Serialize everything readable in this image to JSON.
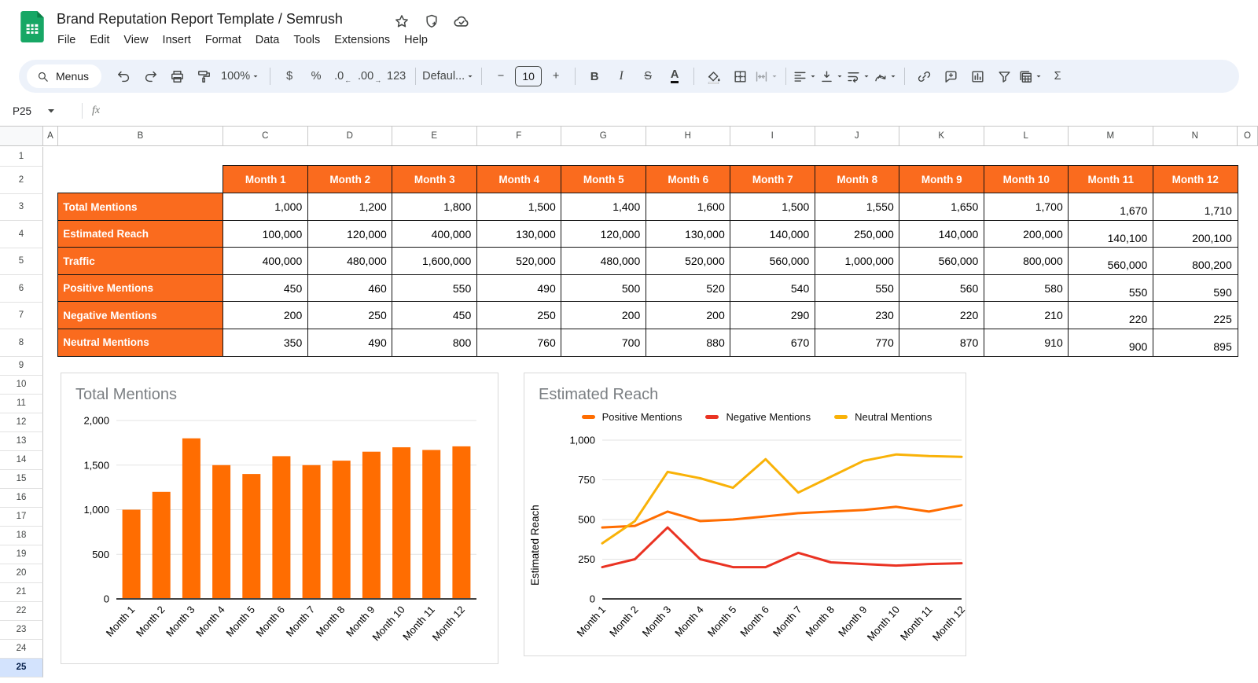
{
  "header": {
    "title": "Brand Reputation Report Template / Semrush",
    "menu_items": [
      "File",
      "Edit",
      "View",
      "Insert",
      "Format",
      "Data",
      "Tools",
      "Extensions",
      "Help"
    ],
    "title_icons": [
      "star-icon",
      "shield-plus-icon",
      "cloud-check-icon"
    ]
  },
  "toolbar": {
    "items": [
      {
        "name": "menus-search",
        "kind": "pill",
        "icon": "search",
        "label": "Menus"
      },
      {
        "name": "undo",
        "kind": "icon",
        "icon": "undo"
      },
      {
        "name": "redo",
        "kind": "icon",
        "icon": "redo"
      },
      {
        "name": "print",
        "kind": "icon",
        "icon": "print"
      },
      {
        "name": "paint-format",
        "kind": "icon",
        "icon": "paint"
      },
      {
        "name": "zoom",
        "kind": "textcaret",
        "label": "100%"
      },
      {
        "kind": "sep"
      },
      {
        "name": "format-as-currency",
        "kind": "text",
        "label": "$"
      },
      {
        "name": "format-as-percent",
        "kind": "text",
        "label": "%"
      },
      {
        "name": "decrease-decimal-places",
        "kind": "text",
        "label": ".0",
        "sub": "←"
      },
      {
        "name": "increase-decimal-places",
        "kind": "text",
        "label": ".00",
        "sub": "→"
      },
      {
        "name": "more-formats",
        "kind": "text",
        "label": "123"
      },
      {
        "kind": "sep"
      },
      {
        "name": "font",
        "kind": "textcaret",
        "label": "Defaul..."
      },
      {
        "kind": "sep"
      },
      {
        "name": "decrease-font-size",
        "kind": "text",
        "label": "−"
      },
      {
        "name": "font-size",
        "kind": "input",
        "label": "10"
      },
      {
        "name": "increase-font-size",
        "kind": "text",
        "label": "+"
      },
      {
        "kind": "sep"
      },
      {
        "name": "bold",
        "kind": "text",
        "label": "B",
        "cls": "b"
      },
      {
        "name": "italic",
        "kind": "text",
        "label": "I",
        "cls": "i"
      },
      {
        "name": "strikethrough",
        "kind": "text",
        "label": "S",
        "cls": "s"
      },
      {
        "name": "text-color",
        "kind": "text",
        "label": "A",
        "cls": "u"
      },
      {
        "kind": "sep"
      },
      {
        "name": "fill-color",
        "kind": "icon",
        "icon": "fill"
      },
      {
        "name": "borders",
        "kind": "icon",
        "icon": "borders"
      },
      {
        "name": "merge-cells",
        "kind": "iconcaret",
        "icon": "merge",
        "disabled": true
      },
      {
        "kind": "sep"
      },
      {
        "name": "horizontal-align",
        "kind": "iconcaret",
        "icon": "alignLeft"
      },
      {
        "name": "vertical-align",
        "kind": "iconcaret",
        "icon": "valign"
      },
      {
        "name": "text-wrapping",
        "kind": "iconcaret",
        "icon": "wrap"
      },
      {
        "name": "text-rotation",
        "kind": "iconcaret",
        "icon": "rotate"
      },
      {
        "kind": "sep"
      },
      {
        "name": "insert-link",
        "kind": "icon",
        "icon": "link"
      },
      {
        "name": "insert-comment",
        "kind": "icon",
        "icon": "comment"
      },
      {
        "name": "insert-chart",
        "kind": "icon",
        "icon": "chart"
      },
      {
        "name": "create-filter",
        "kind": "icon",
        "icon": "filter"
      },
      {
        "name": "table-views",
        "kind": "iconcaret",
        "icon": "tableViews"
      },
      {
        "name": "functions",
        "kind": "text",
        "label": "Σ"
      }
    ]
  },
  "formula_bar": {
    "name_box": "P25",
    "fx_label": "fx"
  },
  "grid": {
    "columns": [
      "A",
      "B",
      "C",
      "D",
      "E",
      "F",
      "G",
      "H",
      "I",
      "J",
      "K",
      "L",
      "M",
      "N",
      "O"
    ],
    "rows": [
      "1",
      "2",
      "3",
      "4",
      "5",
      "6",
      "7",
      "8",
      "9",
      "10",
      "11",
      "12",
      "13",
      "14",
      "15",
      "16",
      "17",
      "18",
      "19",
      "20",
      "21",
      "22",
      "23",
      "24",
      "25"
    ],
    "selected_row": "25"
  },
  "table": {
    "month_headers": [
      "Month 1",
      "Month 2",
      "Month 3",
      "Month 4",
      "Month 5",
      "Month 6",
      "Month 7",
      "Month 8",
      "Month 9",
      "Month 10",
      "Month 11",
      "Month 12"
    ],
    "rows": [
      {
        "label": "Total Mentions",
        "values": [
          "1,000",
          "1,200",
          "1,800",
          "1,500",
          "1,400",
          "1,600",
          "1,500",
          "1,550",
          "1,650",
          "1,700",
          "1,670",
          "1,710"
        ]
      },
      {
        "label": "Estimated Reach",
        "values": [
          "100,000",
          "120,000",
          "400,000",
          "130,000",
          "120,000",
          "130,000",
          "140,000",
          "250,000",
          "140,000",
          "200,000",
          "140,100",
          "200,100"
        ]
      },
      {
        "label": "Traffic",
        "values": [
          "400,000",
          "480,000",
          "1,600,000",
          "520,000",
          "480,000",
          "520,000",
          "560,000",
          "1,000,000",
          "560,000",
          "800,000",
          "560,000",
          "800,200"
        ]
      },
      {
        "label": "Positive Mentions",
        "values": [
          "450",
          "460",
          "550",
          "490",
          "500",
          "520",
          "540",
          "550",
          "560",
          "580",
          "550",
          "590"
        ]
      },
      {
        "label": "Negative Mentions",
        "values": [
          "200",
          "250",
          "450",
          "250",
          "200",
          "200",
          "290",
          "230",
          "220",
          "210",
          "220",
          "225"
        ]
      },
      {
        "label": "Neutral Mentions",
        "values": [
          "350",
          "490",
          "800",
          "760",
          "700",
          "880",
          "670",
          "770",
          "870",
          "910",
          "900",
          "895"
        ]
      }
    ]
  },
  "colors": {
    "table_orange": "#FA6B1E",
    "chart_orange": "#FF6D01",
    "chart_red": "#EA3323",
    "chart_yellow": "#F9B208",
    "selected_row_bg": "#d3e3fd",
    "toolbar_bg": "#edf2fa",
    "sheets_green": "#17A765"
  },
  "chart_data": [
    {
      "type": "bar",
      "title": "Total Mentions",
      "categories": [
        "Month 1",
        "Month 2",
        "Month 3",
        "Month 4",
        "Month 5",
        "Month 6",
        "Month 7",
        "Month 8",
        "Month 9",
        "Month 10",
        "Month 11",
        "Month 12"
      ],
      "values": [
        1000,
        1200,
        1800,
        1500,
        1400,
        1600,
        1500,
        1550,
        1650,
        1700,
        1670,
        1710
      ],
      "color": "#FF6D01",
      "xlabel": "",
      "ylabel": "",
      "ylim": [
        0,
        2000
      ],
      "yticks": [
        0,
        500,
        1000,
        1500,
        2000
      ],
      "grid": true,
      "legend_position": "none"
    },
    {
      "type": "line",
      "title": "Estimated Reach",
      "categories": [
        "Month 1",
        "Month 2",
        "Month 3",
        "Month 4",
        "Month 5",
        "Month 6",
        "Month 7",
        "Month 8",
        "Month 9",
        "Month 10",
        "Month 11",
        "Month 12"
      ],
      "series": [
        {
          "name": "Positive Mentions",
          "color": "#FF6D01",
          "values": [
            450,
            460,
            550,
            490,
            500,
            520,
            540,
            550,
            560,
            580,
            550,
            590
          ]
        },
        {
          "name": "Negative Mentions",
          "color": "#EA3323",
          "values": [
            200,
            250,
            450,
            250,
            200,
            200,
            290,
            230,
            220,
            210,
            220,
            225
          ]
        },
        {
          "name": "Neutral Mentions",
          "color": "#F9B208",
          "values": [
            350,
            490,
            800,
            760,
            700,
            880,
            670,
            770,
            870,
            910,
            900,
            895
          ]
        }
      ],
      "xlabel": "",
      "ylabel": "Estimated Reach",
      "ylim": [
        0,
        1000
      ],
      "yticks": [
        0,
        250,
        500,
        750,
        1000
      ],
      "grid": true,
      "legend_position": "top"
    }
  ]
}
